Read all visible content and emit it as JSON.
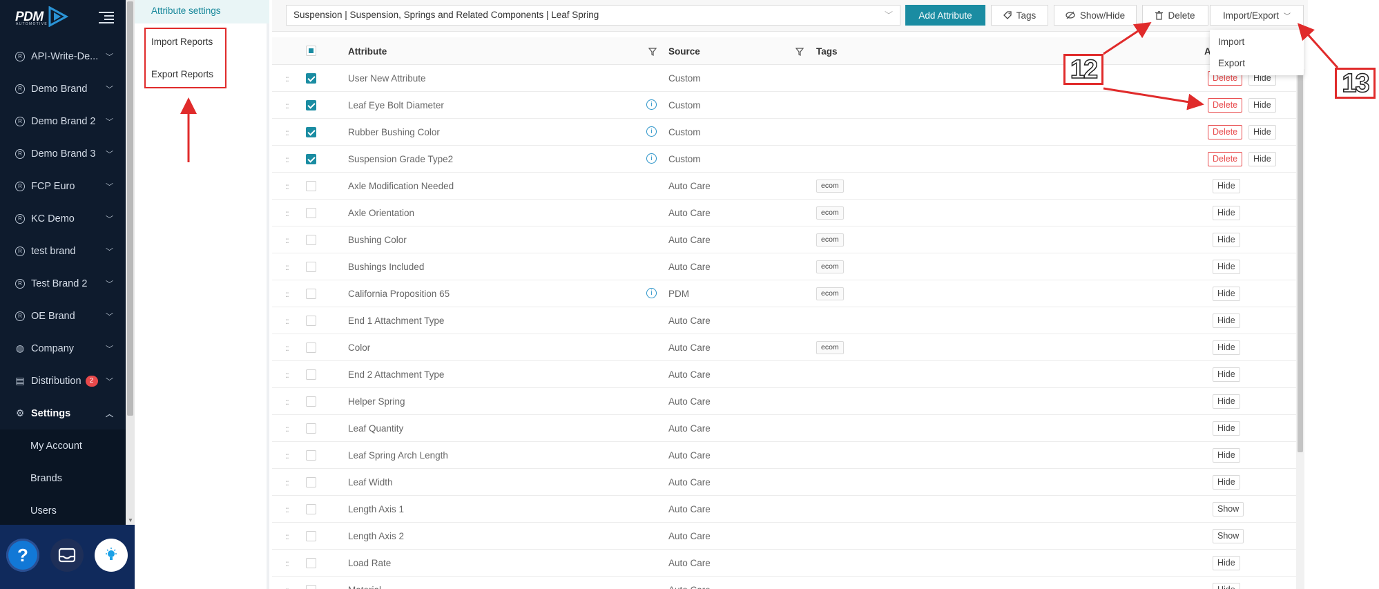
{
  "logo": {
    "word": "PDM",
    "sub": "AUTOMOTIVE"
  },
  "sidebar": {
    "items": [
      {
        "label": "API-Write-De...",
        "icon": "registered-icon"
      },
      {
        "label": "Demo Brand",
        "icon": "registered-icon"
      },
      {
        "label": "Demo Brand 2",
        "icon": "registered-icon"
      },
      {
        "label": "Demo Brand 3",
        "icon": "registered-icon"
      },
      {
        "label": "FCP Euro",
        "icon": "registered-icon"
      },
      {
        "label": "KC Demo",
        "icon": "registered-icon"
      },
      {
        "label": "test brand",
        "icon": "registered-icon"
      },
      {
        "label": "Test Brand 2",
        "icon": "registered-icon"
      },
      {
        "label": "OE Brand",
        "icon": "registered-icon"
      },
      {
        "label": "Company",
        "icon": "globe-icon"
      },
      {
        "label": "Distribution",
        "icon": "distribution-icon",
        "badge": "2"
      },
      {
        "label": "Settings",
        "icon": "gear-icon"
      }
    ],
    "settings_sub": [
      "My Account",
      "Brands",
      "Users"
    ]
  },
  "subpanel": {
    "active": "Attribute settings",
    "import_reports": "Import Reports",
    "export_reports": "Export Reports"
  },
  "toolbar": {
    "category": "Suspension | Suspension, Springs and Related Components | Leaf Spring",
    "add_attribute": "Add Attribute",
    "tags": "Tags",
    "show_hide": "Show/Hide",
    "delete": "Delete",
    "import_export": "Import/Export"
  },
  "dropdown": {
    "import": "Import",
    "export": "Export"
  },
  "table": {
    "headers": {
      "attribute": "Attribute",
      "source": "Source",
      "tags": "Tags",
      "actions": "A"
    },
    "rows": [
      {
        "attr": "User New Attribute",
        "info": false,
        "source": "Custom",
        "tag": "",
        "checked": true,
        "actions": [
          "Delete",
          "Hide"
        ]
      },
      {
        "attr": "Leaf Eye Bolt Diameter",
        "info": true,
        "source": "Custom",
        "tag": "",
        "checked": true,
        "actions": [
          "Delete",
          "Hide"
        ]
      },
      {
        "attr": "Rubber Bushing Color",
        "info": true,
        "source": "Custom",
        "tag": "",
        "checked": true,
        "actions": [
          "Delete",
          "Hide"
        ]
      },
      {
        "attr": "Suspension Grade Type2",
        "info": true,
        "source": "Custom",
        "tag": "",
        "checked": true,
        "actions": [
          "Delete",
          "Hide"
        ]
      },
      {
        "attr": "Axle Modification Needed",
        "info": false,
        "source": "Auto Care",
        "tag": "ecom",
        "checked": false,
        "actions": [
          "Hide"
        ]
      },
      {
        "attr": "Axle Orientation",
        "info": false,
        "source": "Auto Care",
        "tag": "ecom",
        "checked": false,
        "actions": [
          "Hide"
        ]
      },
      {
        "attr": "Bushing Color",
        "info": false,
        "source": "Auto Care",
        "tag": "ecom",
        "checked": false,
        "actions": [
          "Hide"
        ]
      },
      {
        "attr": "Bushings Included",
        "info": false,
        "source": "Auto Care",
        "tag": "ecom",
        "checked": false,
        "actions": [
          "Hide"
        ]
      },
      {
        "attr": "California Proposition 65",
        "info": true,
        "source": "PDM",
        "tag": "ecom",
        "checked": false,
        "actions": [
          "Hide"
        ]
      },
      {
        "attr": "End 1 Attachment Type",
        "info": false,
        "source": "Auto Care",
        "tag": "",
        "checked": false,
        "actions": [
          "Hide"
        ]
      },
      {
        "attr": "Color",
        "info": false,
        "source": "Auto Care",
        "tag": "ecom",
        "checked": false,
        "actions": [
          "Hide"
        ]
      },
      {
        "attr": "End 2 Attachment Type",
        "info": false,
        "source": "Auto Care",
        "tag": "",
        "checked": false,
        "actions": [
          "Hide"
        ]
      },
      {
        "attr": "Helper Spring",
        "info": false,
        "source": "Auto Care",
        "tag": "",
        "checked": false,
        "actions": [
          "Hide"
        ]
      },
      {
        "attr": "Leaf Quantity",
        "info": false,
        "source": "Auto Care",
        "tag": "",
        "checked": false,
        "actions": [
          "Hide"
        ]
      },
      {
        "attr": "Leaf Spring Arch Length",
        "info": false,
        "source": "Auto Care",
        "tag": "",
        "checked": false,
        "actions": [
          "Hide"
        ]
      },
      {
        "attr": "Leaf Width",
        "info": false,
        "source": "Auto Care",
        "tag": "",
        "checked": false,
        "actions": [
          "Hide"
        ]
      },
      {
        "attr": "Length Axis 1",
        "info": false,
        "source": "Auto Care",
        "tag": "",
        "checked": false,
        "actions": [
          "Show"
        ]
      },
      {
        "attr": "Length Axis 2",
        "info": false,
        "source": "Auto Care",
        "tag": "",
        "checked": false,
        "actions": [
          "Show"
        ]
      },
      {
        "attr": "Load Rate",
        "info": false,
        "source": "Auto Care",
        "tag": "",
        "checked": false,
        "actions": [
          "Hide"
        ]
      },
      {
        "attr": "Material",
        "info": false,
        "source": "Auto Care",
        "tag": "",
        "checked": false,
        "actions": [
          "Hide"
        ]
      }
    ]
  },
  "annotations": {
    "callout_12": "12",
    "callout_13": "13"
  },
  "colors": {
    "accent": "#1a8ca2",
    "sidebar": "#0e1b2d",
    "danger": "#e8494b",
    "annotation": "#e02b2b"
  }
}
